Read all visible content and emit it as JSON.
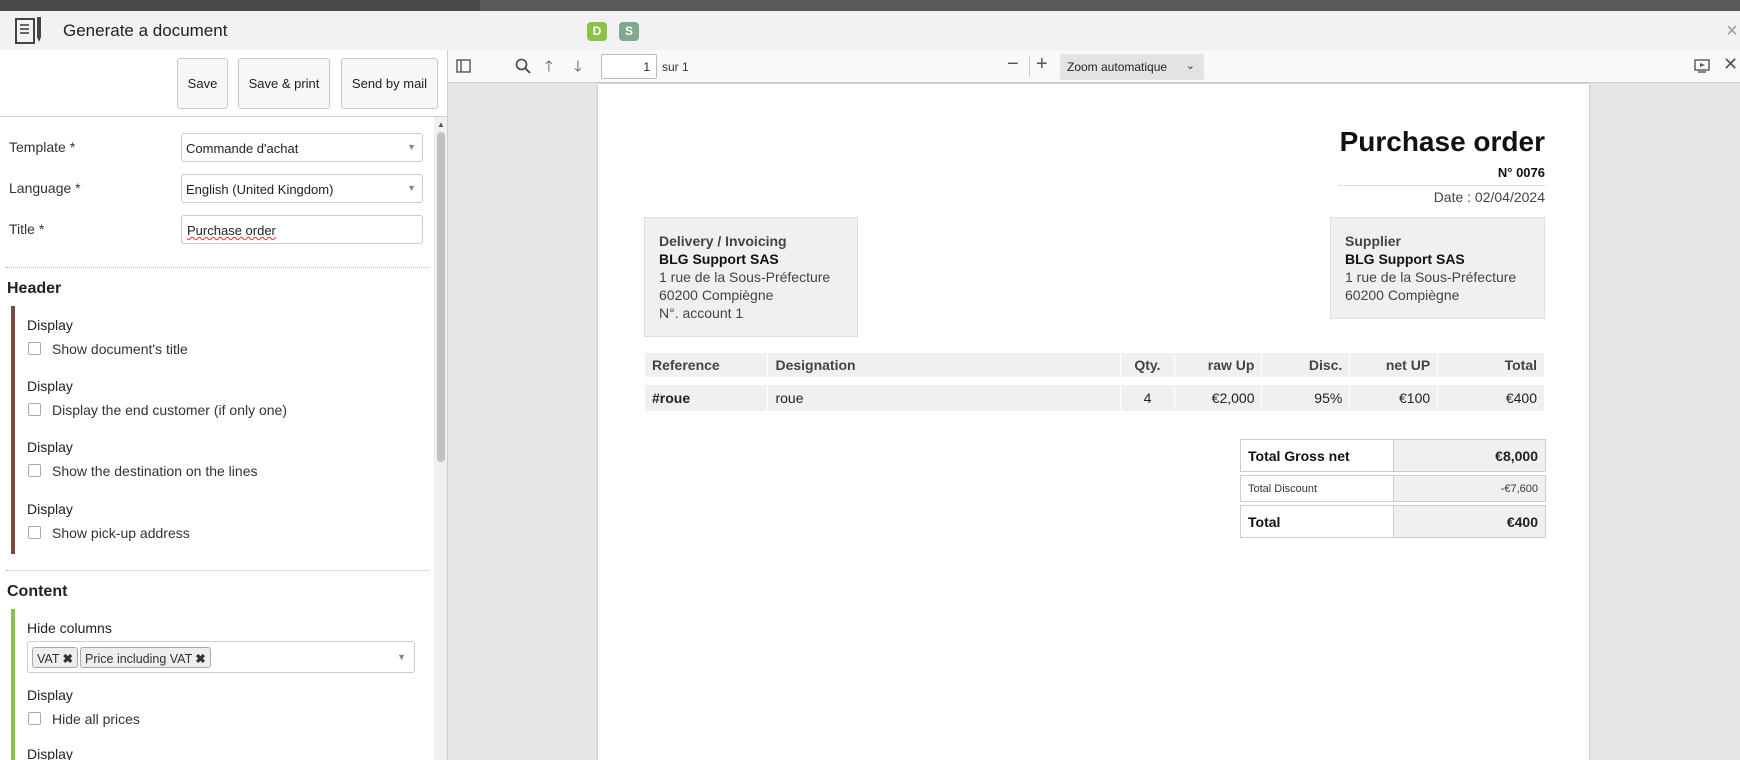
{
  "dialog": {
    "title": "Generate a document",
    "badges": [
      "D",
      "S"
    ],
    "close_label": "×"
  },
  "actions": {
    "save": "Save",
    "save_print": "Save & print",
    "send_mail": "Send by mail"
  },
  "form": {
    "template_label": "Template *",
    "template_value": "Commande d'achat",
    "language_label": "Language *",
    "language_value": "English (United Kingdom)",
    "title_label": "Title *",
    "title_value": "Purchase order"
  },
  "header_section": {
    "title": "Header",
    "options": [
      {
        "group": "Display",
        "label": "Show document's title",
        "checked": false
      },
      {
        "group": "Display",
        "label": "Display the end customer (if only one)",
        "checked": false
      },
      {
        "group": "Display",
        "label": "Show the destination on the lines",
        "checked": false
      },
      {
        "group": "Display",
        "label": "Show pick-up address",
        "checked": false
      }
    ]
  },
  "content_section": {
    "title": "Content",
    "hide_columns_label": "Hide columns",
    "hidden_columns": [
      "VAT",
      "Price including VAT"
    ],
    "options": [
      {
        "group": "Display",
        "label": "Hide all prices",
        "checked": false
      },
      {
        "group": "Display"
      }
    ]
  },
  "viewer": {
    "page_current": "1",
    "page_total_text": "sur 1",
    "zoom": "Zoom automatique",
    "icons": [
      "sidebar-toggle-icon",
      "search-icon",
      "arrow-up-icon",
      "arrow-down-icon",
      "zoom-out-icon",
      "zoom-in-icon",
      "presentation-icon",
      "close-icon"
    ]
  },
  "document": {
    "title": "Purchase order",
    "number": "N° 0076",
    "date": "Date : 02/04/2024",
    "delivery": {
      "heading": "Delivery / Invoicing",
      "name": "BLG Support SAS",
      "lines": [
        "1 rue de la Sous-Préfecture",
        "60200 Compiègne",
        "N°. account 1"
      ]
    },
    "supplier": {
      "heading": "Supplier",
      "name": "BLG Support SAS",
      "lines": [
        "1 rue de la Sous-Préfecture",
        "60200 Compiègne"
      ]
    },
    "columns": [
      "Reference",
      "Designation",
      "Qty.",
      "raw Up",
      "Disc.",
      "net UP",
      "Total"
    ],
    "rows": [
      {
        "reference": "#roue",
        "designation": "roue",
        "qty": "4",
        "raw_up": "€2,000",
        "disc": "95%",
        "net_up": "€100",
        "total": "€400"
      }
    ],
    "totals": {
      "gross_label": "Total Gross net",
      "gross_value": "€8,000",
      "discount_label": "Total Discount",
      "discount_value": "-€7,600",
      "total_label": "Total",
      "total_value": "€400"
    }
  },
  "colors": {
    "header_bar": "#7a4a3a",
    "content_bar": "#8bc34a",
    "badge_d": "#8bc34a",
    "badge_s": "#7fa88c"
  }
}
